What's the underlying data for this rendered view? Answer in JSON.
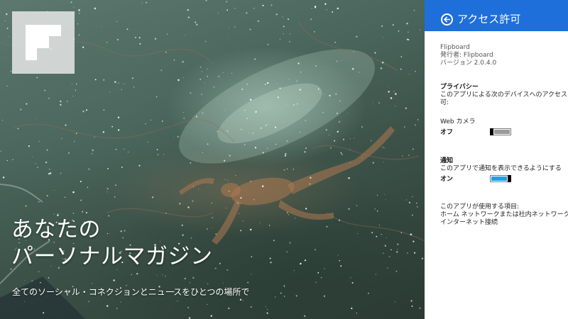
{
  "hero": {
    "title_line1": "あなたの",
    "title_line2": "パーソナルマガジン",
    "subtitle": "全てのソーシャル・コネクションとニュースをひとつの場所で"
  },
  "pane": {
    "title": "アクセス許可",
    "back_icon": "back-arrow-circle-icon",
    "header_color": "#1e6fd9",
    "app_name": "Flipboard",
    "publisher": "発行者: Flipboard",
    "version": "バージョン 2.0.4.0",
    "privacy_heading": "プライバシー",
    "privacy_desc_line1": "このアプリによる次のデバイスへのアクセスを許",
    "privacy_desc_line2": "可:",
    "webcam": {
      "label": "Web カメラ",
      "state_label": "オフ",
      "on": false
    },
    "notifications": {
      "label": "通知",
      "desc": "このアプリで通知を表示できるようにする",
      "state_label": "オン",
      "on": true
    },
    "uses_heading": "このアプリが使用する項目:",
    "uses_line1": "ホーム ネットワークまたは社内ネットワーク",
    "uses_line2": "インターネット接続"
  },
  "colors": {
    "toggle_on": "#1aa1e6",
    "toggle_off": "#9a9a9a"
  }
}
